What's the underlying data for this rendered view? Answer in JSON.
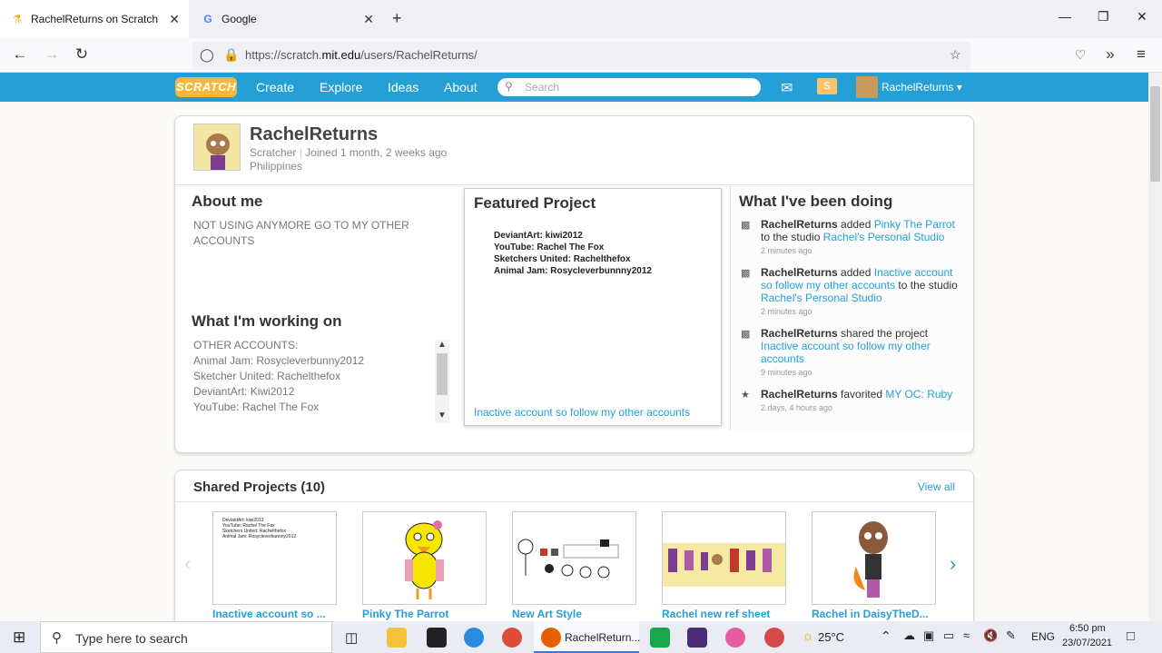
{
  "browser": {
    "tabs": [
      {
        "title": "RachelReturns on Scratch",
        "favicon": "scratch-favicon"
      },
      {
        "title": "Google",
        "favicon": "google-favicon"
      }
    ],
    "url_prefix": "https://scratch.",
    "url_domain": "mit.edu",
    "url_path": "/users/RachelReturns/"
  },
  "scratch_header": {
    "logo": "SCRATCH",
    "nav": [
      "Create",
      "Explore",
      "Ideas",
      "About"
    ],
    "search_placeholder": "Search",
    "username": "RachelReturns"
  },
  "profile": {
    "name": "RachelReturns",
    "role": "Scratcher",
    "joined": "Joined 1 month, 2 weeks ago",
    "country": "Philippines",
    "about_title": "About me",
    "about_text": "NOT USING ANYMORE GO TO MY OTHER ACCOUNTS",
    "working_title": "What I'm working on",
    "working_lines": [
      "OTHER ACCOUNTS:",
      "Animal Jam: Rosycleverbunny2012",
      "Sketcher United: Rachelthefox",
      "DeviantArt: Kiwi2012",
      "YouTube: Rachel The Fox"
    ],
    "featured_title": "Featured Project",
    "featured_lines": [
      "DeviantArt: kiwi2012",
      "YouTube: Rachel The Fox",
      "Sketchers United: Rachelthefox",
      "Animal Jam: Rosycleverbunnny2012"
    ],
    "featured_link": "Inactive account so follow my other accounts",
    "activity_title": "What I've been doing",
    "activity": [
      {
        "user": "RachelReturns",
        "verb": " added ",
        "target": "Pinky The Parrot",
        "mid": " to the studio ",
        "target2": "Rachel's Personal Studio",
        "time": "2 minutes ago"
      },
      {
        "user": "RachelReturns",
        "verb": " added ",
        "target": "Inactive account so follow my other accounts",
        "mid": " to the studio ",
        "target2": "Rachel's Personal Studio",
        "time": "2 minutes ago"
      },
      {
        "user": "RachelReturns",
        "verb": " shared the project ",
        "target": "Inactive account so follow my other accounts",
        "mid": "",
        "target2": "",
        "time": "9 minutes ago"
      },
      {
        "user": "RachelReturns",
        "verb": " favorited ",
        "target": "MY OC: Ruby",
        "mid": "",
        "target2": "",
        "time": "2 days, 4 hours ago"
      }
    ]
  },
  "shared": {
    "title": "Shared Projects (10)",
    "view_all": "View all",
    "projects": [
      {
        "title": "Inactive account so ..."
      },
      {
        "title": "Pinky The Parrot"
      },
      {
        "title": "New Art Style"
      },
      {
        "title": "Rachel new ref sheet"
      },
      {
        "title": "Rachel in DaisyTheD..."
      }
    ],
    "thumb_lines": [
      "DeviantArt: kiwi2012",
      "YouTube: Rachel The Fox",
      "Sketchers United: Rachelthefox",
      "Animal Jam: Rosycleverbunnny2012"
    ]
  },
  "taskbar": {
    "search_placeholder": "Type here to search",
    "active_app": "RachelReturn...",
    "temperature": "25°C",
    "language": "ENG",
    "time": "6:50 pm",
    "date": "23/07/2021"
  }
}
